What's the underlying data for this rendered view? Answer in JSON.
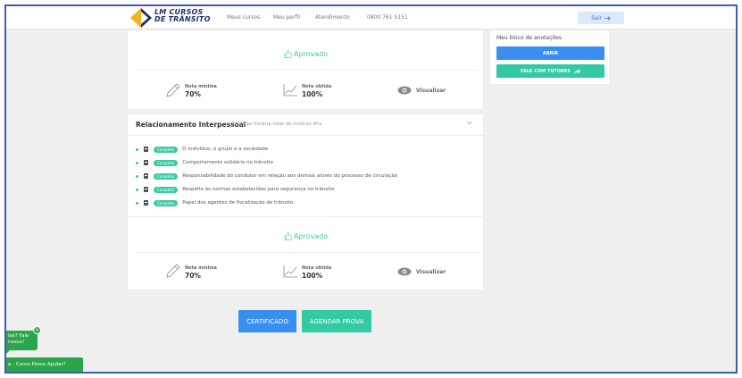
{
  "nav": {
    "brand_line1": "LM CURSOS",
    "brand_line2": "DE TRÂNSITO",
    "links": [
      "Meus cursos",
      "Meu perfil",
      "Atendimento",
      "0800 761 5151"
    ],
    "exit_label": "Sair"
  },
  "module1": {
    "status": "Aprovado",
    "min_label": "Nota mínima",
    "min_value": "70%",
    "obtained_label": "Nota obtida",
    "obtained_value": "100%",
    "view_label": "Visualizar"
  },
  "module2": {
    "title": "Relacionamento Interpessoal",
    "subtitle": "Carga horária total do módulo 6hs",
    "lessons": [
      {
        "badge": "Completo",
        "title": "O indivíduo, o grupo e a sociedade"
      },
      {
        "badge": "Completo",
        "title": "Comportamento solidário no trânsito"
      },
      {
        "badge": "Completo",
        "title": "Responsabilidade do condutor em relação aos demais atores do processo de circulação"
      },
      {
        "badge": "Completo",
        "title": "Respeito às normas estabelecidas para segurança no trânsito"
      },
      {
        "badge": "Completo",
        "title": "Papel dos agentes de fiscalização de trânsito"
      }
    ],
    "status": "Aprovado",
    "min_label": "Nota mínima",
    "min_value": "70%",
    "obtained_label": "Nota obtida",
    "obtained_value": "100%",
    "view_label": "Visualizar"
  },
  "side": {
    "title": "Meu bloco de anotações",
    "open_label": "ABRIR",
    "tutors_label": "FALE COM TUTORES"
  },
  "actions": {
    "certificate_label": "CERTIFICADO",
    "schedule_label": "AGENDAR PROVA"
  },
  "chat": {
    "bubble_line1": "las? Fale",
    "bubble_line2": "nosco!",
    "bar_label": "e - Como Posso Ajudar?"
  },
  "colors": {
    "primary": "#3a8ef0",
    "accent": "#33c9a2",
    "chat": "#2aa54a",
    "frame": "#3e5db3"
  }
}
